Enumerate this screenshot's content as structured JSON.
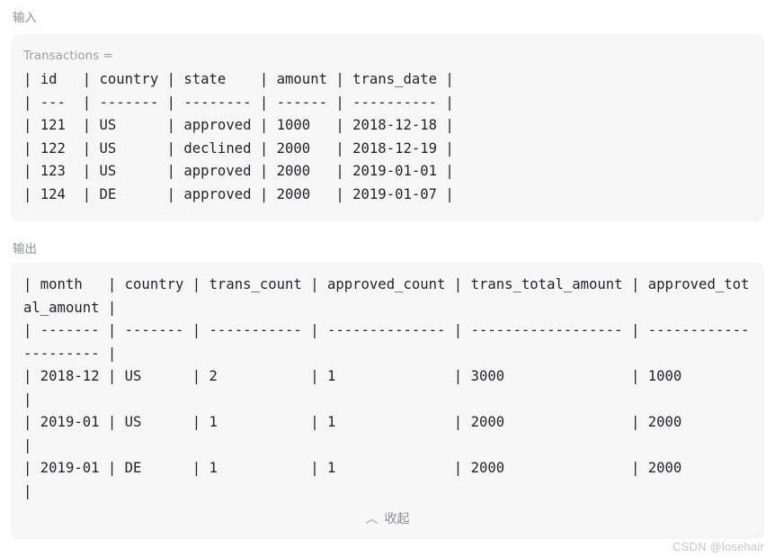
{
  "sections": {
    "input": {
      "label": "输入",
      "var_label": "Transactions =",
      "table_text": "| id   | country | state    | amount | trans_date |\n| ---  | ------- | -------- | ------ | ---------- |\n| 121  | US      | approved | 1000   | 2018-12-18 |\n| 122  | US      | declined | 2000   | 2018-12-19 |\n| 123  | US      | approved | 2000   | 2019-01-01 |\n| 124  | DE      | approved | 2000   | 2019-01-07 |"
    },
    "output": {
      "label": "输出",
      "table_text": "| month   | country | trans_count | approved_count | trans_total_amount | approved_total_amount |\n| ------- | ------- | ----------- | -------------- | ------------------ | --------------------- |\n| 2018-12 | US      | 2           | 1              | 3000               | 1000                  |\n| 2019-01 | US      | 1           | 1              | 2000               | 2000                  |\n| 2019-01 | DE      | 1           | 1              | 2000               | 2000                  |"
    }
  },
  "collapse": {
    "icon": "chevron-up-icon",
    "glyph": "︿",
    "label": "收起"
  },
  "watermark": {
    "text": "CSDN @losehair"
  },
  "colors": {
    "page_background": "#ffffff",
    "card_background": "#f6f6f7",
    "code_text": "#1f2328",
    "muted_label": "#8a8f99",
    "var_label": "#9aa0a6",
    "watermark": "#c3c6cb"
  },
  "table_data": {
    "input": {
      "name": "Transactions",
      "columns": [
        "id",
        "country",
        "state",
        "amount",
        "trans_date"
      ],
      "rows": [
        [
          "121",
          "US",
          "approved",
          "1000",
          "2018-12-18"
        ],
        [
          "122",
          "US",
          "declined",
          "2000",
          "2018-12-19"
        ],
        [
          "123",
          "US",
          "approved",
          "2000",
          "2019-01-01"
        ],
        [
          "124",
          "DE",
          "approved",
          "2000",
          "2019-01-07"
        ]
      ]
    },
    "output": {
      "columns": [
        "month",
        "country",
        "trans_count",
        "approved_count",
        "trans_total_amount",
        "approved_total_amount"
      ],
      "rows": [
        [
          "2018-12",
          "US",
          "2",
          "1",
          "3000",
          "1000"
        ],
        [
          "2019-01",
          "US",
          "1",
          "1",
          "2000",
          "2000"
        ],
        [
          "2019-01",
          "DE",
          "1",
          "1",
          "2000",
          "2000"
        ]
      ]
    }
  }
}
